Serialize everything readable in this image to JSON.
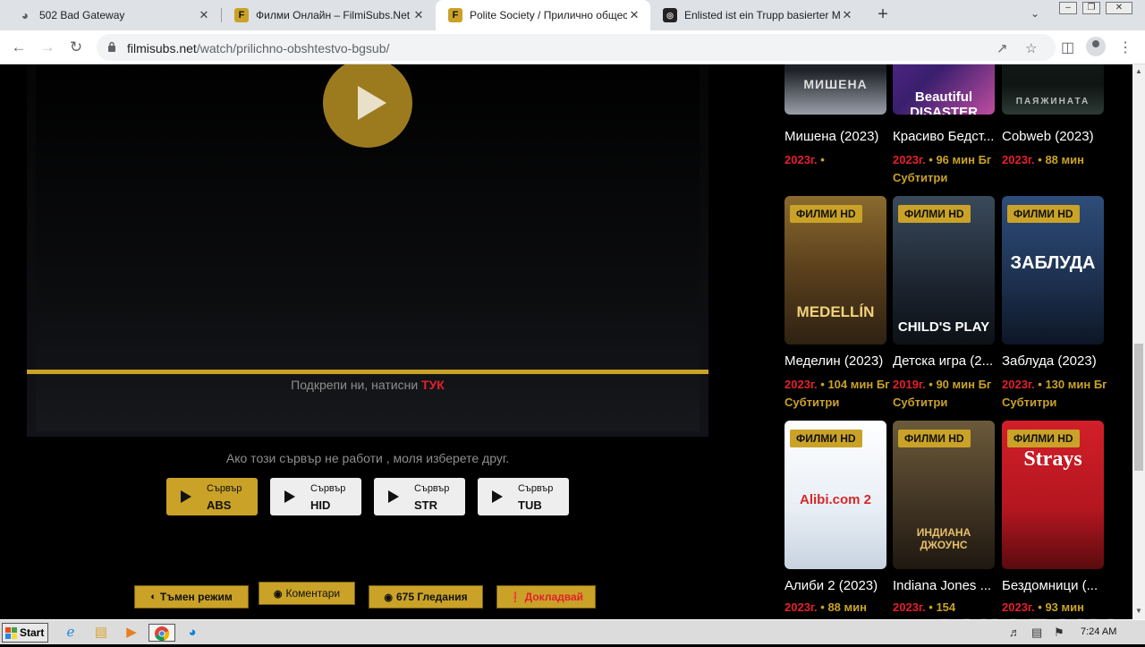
{
  "browser": {
    "tabs": [
      {
        "title": "502 Bad Gateway",
        "icon": "globe-icon"
      },
      {
        "title": "Филми Онлайн – FilmiSubs.Net",
        "icon": "filmisubs-favicon"
      },
      {
        "title": "Polite Society / Приличнo обществo",
        "icon": "filmisubs-favicon"
      },
      {
        "title": "Enlisted ist ein Trupp basierter MMO-",
        "icon": "enlisted-favicon"
      }
    ],
    "close_glyph": "✕",
    "new_tab_glyph": "+",
    "url_host": "filmisubs.net",
    "url_path": "/watch/prilichno-obshtestvo-bgsub/"
  },
  "player": {
    "support_text": "Подкрепи ни, натисни",
    "support_link": "ТУК",
    "server_note": "Ако този сървър не работи , моля изберете друг.",
    "server_label": "Сървър",
    "servers": [
      "ABS",
      "HID",
      "STR",
      "TUB"
    ],
    "active_server": "ABS"
  },
  "actions": {
    "dark_mode": "Тъмен режим",
    "comments": "Коментари",
    "views": "675 Гледания",
    "report": "Докладвай"
  },
  "movies": [
    {
      "title": "Мишена (2023)",
      "year": "2023г.",
      "meta": "•",
      "poster_text": "МИШЕНА",
      "badge": ""
    },
    {
      "title": "Красиво Бедст...",
      "year": "2023г.",
      "meta": "• 96 мин Бг Субтитри",
      "poster_text": "Beautiful DISASTER",
      "badge": ""
    },
    {
      "title": "Cobweb (2023)",
      "year": "2023г.",
      "meta": "• 88 мин",
      "poster_text": "ПАЯЖИНАТА",
      "badge": ""
    },
    {
      "title": "Меделин (2023)",
      "year": "2023г.",
      "meta": "• 104 мин Бг Субтитри",
      "poster_text": "MEDELLÍN",
      "badge": "ФИЛМИ HD"
    },
    {
      "title": "Детска игра (2...",
      "year": "2019г.",
      "meta": "• 90 мин Бг Субтитри",
      "poster_text": "CHILD'S PLAY",
      "badge": "ФИЛМИ HD"
    },
    {
      "title": "Заблуда (2023)",
      "year": "2023г.",
      "meta": "• 130 мин Бг Субтитри",
      "poster_text": "ЗАБЛУДА",
      "badge": "ФИЛМИ HD"
    },
    {
      "title": "Алиби 2 (2023)",
      "year": "2023г.",
      "meta": "• 88 мин",
      "poster_text": "Alibi.com 2",
      "badge": "ФИЛМИ HD"
    },
    {
      "title": "Indiana Jones ...",
      "year": "2023г.",
      "meta": "• 154",
      "poster_text": "ИНДИАНА ДЖОУНС",
      "badge": "ФИЛМИ HD"
    },
    {
      "title": "Бездомници (...",
      "year": "2023г.",
      "meta": "• 93 мин",
      "poster_text": "Strays",
      "badge": "ФИЛМИ HD"
    }
  ],
  "watermark": "ANY.RUN",
  "taskbar": {
    "start_label": "Start",
    "clock": "7:24 AM"
  }
}
